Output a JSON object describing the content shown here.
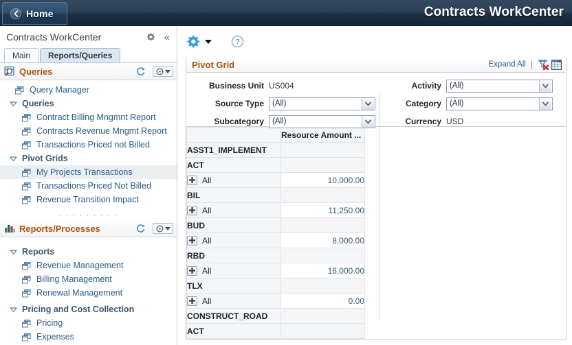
{
  "topbar": {
    "home_label": "Home",
    "back_icon": "chevron-left-icon",
    "app_title": "Contracts WorkCenter"
  },
  "sidebar": {
    "title": "Contracts WorkCenter",
    "gear_icon": "gear-icon",
    "collapse_icon": "collapse-double-chevron-icon",
    "tabs": [
      {
        "label": "Main",
        "active": false
      },
      {
        "label": "Reports/Queries",
        "active": true
      }
    ],
    "sections": [
      {
        "title": "Queries",
        "icon": "query-magnifier-icon",
        "refresh_icon": "refresh-icon",
        "menu_icon": "gear-dropdown-icon",
        "items": [
          {
            "label": "Query Manager",
            "type": "link",
            "indent": 1
          },
          {
            "label": "Queries",
            "type": "group",
            "indent": 0,
            "twist": "expanded"
          },
          {
            "label": "Contract Billing Mngmnt Report",
            "type": "link",
            "indent": 2
          },
          {
            "label": "Contracts Revenue Mngmt Report",
            "type": "link",
            "indent": 2
          },
          {
            "label": "Transactions Priced not Billed",
            "type": "link",
            "indent": 2
          },
          {
            "label": "Pivot Grids",
            "type": "group",
            "indent": 0,
            "twist": "expanded"
          },
          {
            "label": "My Projects Transactions",
            "type": "link",
            "indent": 2,
            "selected": true
          },
          {
            "label": "Transactions Priced Not Billed",
            "type": "link",
            "indent": 2
          },
          {
            "label": "Revenue Transition Impact",
            "type": "link",
            "indent": 2
          }
        ]
      },
      {
        "title": "Reports/Processes",
        "icon": "bar-chart-icon",
        "refresh_icon": "refresh-icon",
        "menu_icon": "gear-dropdown-icon",
        "items": [
          {
            "label": "Reports",
            "type": "group",
            "indent": 0,
            "twist": "expanded"
          },
          {
            "label": "Revenue Management",
            "type": "link",
            "indent": 2
          },
          {
            "label": "Billing Management",
            "type": "link",
            "indent": 2
          },
          {
            "label": "Renewal Management",
            "type": "link",
            "indent": 2
          },
          {
            "label": "Pricing and Cost Collection",
            "type": "group",
            "indent": 0,
            "twist": "expanded"
          },
          {
            "label": "Pricing",
            "type": "link",
            "indent": 2
          },
          {
            "label": "Expenses",
            "type": "link",
            "indent": 2
          }
        ]
      }
    ],
    "drag_handle_dots": "· · · · · · · · ·"
  },
  "main": {
    "toolbar": {
      "actions_icon": "gear-icon",
      "actions_caret_icon": "caret-down-icon",
      "help_icon": "help-question-icon"
    },
    "panel": {
      "title": "Pivot Grid",
      "expand_all_label": "Expand All",
      "separator": "|",
      "clear_filter_icon": "filter-clear-icon",
      "spreadsheet_icon": "grid-view-icon"
    },
    "filters": {
      "left": [
        {
          "label": "Business Unit",
          "value": "US004",
          "control": "text"
        },
        {
          "label": "Source Type",
          "value": "(All)",
          "control": "select"
        },
        {
          "label": "Subcategory",
          "value": "(All)",
          "control": "select"
        }
      ],
      "right": [
        {
          "label": "Activity",
          "value": "(All)",
          "control": "select"
        },
        {
          "label": "Category",
          "value": "(All)",
          "control": "select"
        },
        {
          "label": "Currency",
          "value": "USD",
          "control": "text"
        }
      ],
      "dropdown_arrow_icon": "chevron-down-icon"
    }
  },
  "chart_data": {
    "type": "table",
    "title": "Pivot Grid",
    "columns": [
      "",
      "Resource Amount ..."
    ],
    "value_column_label": "Resource Amount ...",
    "currency": "USD",
    "business_unit": "US004",
    "expand_icon": "plus-icon",
    "rows": [
      {
        "label": "ASST1_IMPLEMENT",
        "level": 0,
        "value": ""
      },
      {
        "label": "ACT",
        "level": 1,
        "value": ""
      },
      {
        "label": "All",
        "level": 2,
        "value": "10,000.00",
        "expander": true
      },
      {
        "label": "BIL",
        "level": 1,
        "value": ""
      },
      {
        "label": "All",
        "level": 2,
        "value": "11,250.00",
        "expander": true
      },
      {
        "label": "BUD",
        "level": 1,
        "value": ""
      },
      {
        "label": "All",
        "level": 2,
        "value": "8,000.00",
        "expander": true
      },
      {
        "label": "RBD",
        "level": 1,
        "value": ""
      },
      {
        "label": "All",
        "level": 2,
        "value": "16,000.00",
        "expander": true
      },
      {
        "label": "TLX",
        "level": 1,
        "value": ""
      },
      {
        "label": "All",
        "level": 2,
        "value": "0.00",
        "expander": true
      },
      {
        "label": "CONSTRUCT_ROAD",
        "level": 0,
        "value": ""
      },
      {
        "label": "ACT",
        "level": 1,
        "value": ""
      }
    ]
  },
  "colors": {
    "topbar_dark": "#1d3046",
    "panel_title_orange": "#b35309",
    "link_blue": "#2a5d93",
    "group_blue": "#3a5874",
    "amount_blue": "#2f5a86",
    "tab_active_bg": "#dce7f2",
    "grid_header_bg": "#f3f5f7"
  }
}
